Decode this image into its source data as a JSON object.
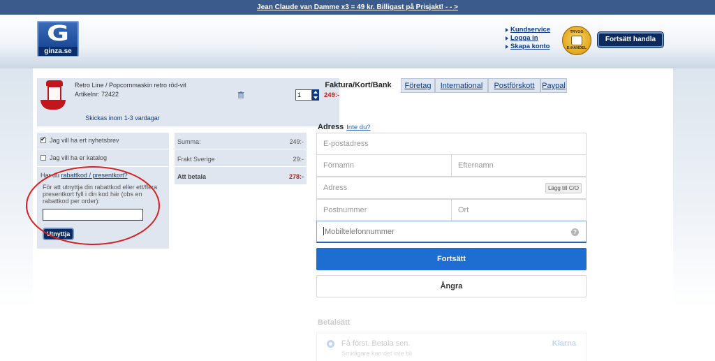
{
  "promo": {
    "text": "Jean Claude van Damme x3 = 49 kr. Billigast på Prisjakt! - - >"
  },
  "header": {
    "logo_letter": "G",
    "logo_text": "ginza.se",
    "links": [
      "Kundservice",
      "Logga in",
      "Skapa konto"
    ],
    "trygg_top": "TRYGG",
    "trygg_bottom": "E-HANDEL",
    "continue_label": "Fortsätt handla"
  },
  "cart": {
    "item_name": "Retro Line / Popcornmaskin retro röd-vit",
    "item_article": "Artikelnr: 72422",
    "quantity": "1",
    "price": "249:-",
    "shipping_time": "Skickas inom 1-3 vardagar"
  },
  "options": {
    "newsletter_label": "Jag vill ha ert nyhetsbrev",
    "newsletter_checked": true,
    "catalog_label": "Jag vill ha er katalog",
    "catalog_checked": false,
    "voucher_question_prefix": "Har du ",
    "voucher_link": "rabattkod / presentkort?",
    "voucher_help": "För att utnyttja din rabattkod eller ett/flera presentkort fyll i din kod här (obs en rabattkod per order):",
    "voucher_value": "",
    "apply_label": "Utnyttja"
  },
  "summary": {
    "rows": [
      {
        "label": "Summa:",
        "value": "249:-"
      },
      {
        "label": "Frakt Sverige",
        "value": "29:-"
      },
      {
        "label": "Att betala",
        "value": "278:-"
      }
    ]
  },
  "tabs": [
    {
      "label": "Faktura/Kort/Bank",
      "active": true
    },
    {
      "label": "Företag",
      "active": false
    },
    {
      "label": "International",
      "active": false
    },
    {
      "label": "Postförskott",
      "active": false
    },
    {
      "label": "Paypal",
      "active": false
    }
  ],
  "address": {
    "title": "Adress",
    "hint": "Inte du?",
    "email_placeholder": "E-postadress",
    "firstname_placeholder": "Förnamn",
    "lastname_placeholder": "Efternamn",
    "address_placeholder": "Adress",
    "co_label": "Lägg till C/O",
    "zip_placeholder": "Postnummer",
    "city_placeholder": "Ort",
    "phone_placeholder": "Mobiltelefonnummer",
    "help_glyph": "?"
  },
  "actions": {
    "continue_label": "Fortsätt",
    "cancel_label": "Ångra"
  },
  "payment": {
    "title": "Betalsätt",
    "option_main": "Få först. Betala sen.",
    "option_sub": "Smidigare kan det inte bli",
    "provider": "Klarna"
  },
  "colors": {
    "brand_blue": "#0b3b86",
    "promo_bar": "#3b5b8c",
    "primary_button": "#1e6ed2",
    "price_red": "#c41a1a",
    "annotation_red": "#d42020"
  }
}
